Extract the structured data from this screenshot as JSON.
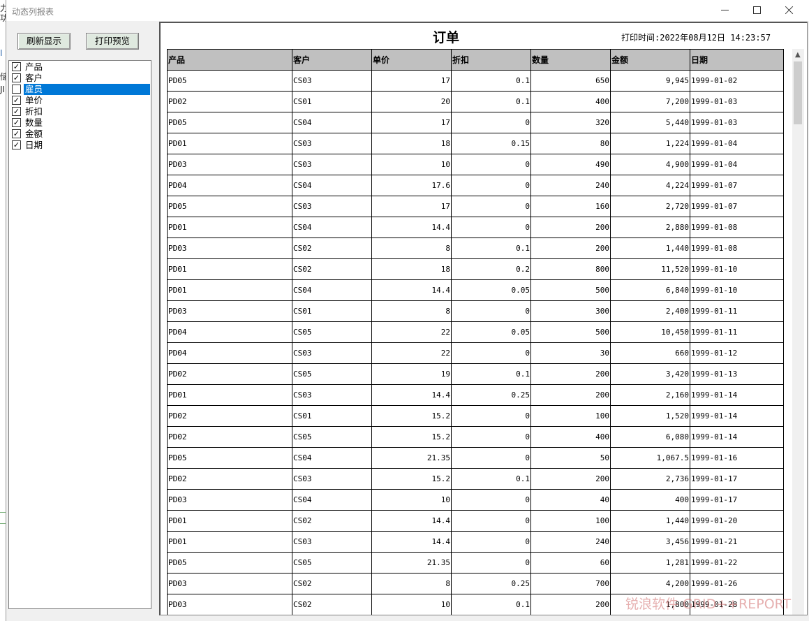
{
  "window": {
    "title": "动态列报表"
  },
  "background_fragments": [
    "力",
    "功",
    "I",
    "储",
    "JI"
  ],
  "toolbar": {
    "refresh_label": "刷新显示",
    "preview_label": "打印预览"
  },
  "columns_panel": {
    "items": [
      {
        "label": "产品",
        "checked": true
      },
      {
        "label": "客户",
        "checked": true
      },
      {
        "label": "雇员",
        "checked": false,
        "selected": true
      },
      {
        "label": "单价",
        "checked": true
      },
      {
        "label": "折扣",
        "checked": true
      },
      {
        "label": "数量",
        "checked": true
      },
      {
        "label": "金额",
        "checked": true
      },
      {
        "label": "日期",
        "checked": true
      }
    ]
  },
  "report": {
    "title": "订单",
    "print_time_label": "打印时间:",
    "print_time": "2022年08月12日 14:23:57",
    "headers": [
      "产品",
      "客户",
      "单价",
      "折扣",
      "数量",
      "金额",
      "日期"
    ],
    "rows": [
      [
        "PD05",
        "CS03",
        "17",
        "0.1",
        "650",
        "9,945",
        "1999-01-02"
      ],
      [
        "PD02",
        "CS01",
        "20",
        "0.1",
        "400",
        "7,200",
        "1999-01-03"
      ],
      [
        "PD05",
        "CS04",
        "17",
        "0",
        "320",
        "5,440",
        "1999-01-03"
      ],
      [
        "PD01",
        "CS03",
        "18",
        "0.15",
        "80",
        "1,224",
        "1999-01-04"
      ],
      [
        "PD03",
        "CS03",
        "10",
        "0",
        "490",
        "4,900",
        "1999-01-04"
      ],
      [
        "PD04",
        "CS04",
        "17.6",
        "0",
        "240",
        "4,224",
        "1999-01-07"
      ],
      [
        "PD05",
        "CS03",
        "17",
        "0",
        "160",
        "2,720",
        "1999-01-07"
      ],
      [
        "PD01",
        "CS04",
        "14.4",
        "0",
        "200",
        "2,880",
        "1999-01-08"
      ],
      [
        "PD03",
        "CS02",
        "8",
        "0.1",
        "200",
        "1,440",
        "1999-01-08"
      ],
      [
        "PD01",
        "CS02",
        "18",
        "0.2",
        "800",
        "11,520",
        "1999-01-10"
      ],
      [
        "PD01",
        "CS04",
        "14.4",
        "0.05",
        "500",
        "6,840",
        "1999-01-10"
      ],
      [
        "PD03",
        "CS01",
        "8",
        "0",
        "300",
        "2,400",
        "1999-01-11"
      ],
      [
        "PD04",
        "CS05",
        "22",
        "0.05",
        "500",
        "10,450",
        "1999-01-11"
      ],
      [
        "PD04",
        "CS03",
        "22",
        "0",
        "30",
        "660",
        "1999-01-12"
      ],
      [
        "PD02",
        "CS05",
        "19",
        "0.1",
        "200",
        "3,420",
        "1999-01-13"
      ],
      [
        "PD01",
        "CS03",
        "14.4",
        "0.25",
        "200",
        "2,160",
        "1999-01-14"
      ],
      [
        "PD02",
        "CS01",
        "15.2",
        "0",
        "100",
        "1,520",
        "1999-01-14"
      ],
      [
        "PD02",
        "CS05",
        "15.2",
        "0",
        "400",
        "6,080",
        "1999-01-14"
      ],
      [
        "PD05",
        "CS04",
        "21.35",
        "0",
        "50",
        "1,067.5",
        "1999-01-16"
      ],
      [
        "PD02",
        "CS03",
        "15.2",
        "0.1",
        "200",
        "2,736",
        "1999-01-17"
      ],
      [
        "PD03",
        "CS04",
        "10",
        "0",
        "40",
        "400",
        "1999-01-17"
      ],
      [
        "PD01",
        "CS02",
        "14.4",
        "0",
        "100",
        "1,440",
        "1999-01-20"
      ],
      [
        "PD01",
        "CS03",
        "14.4",
        "0",
        "240",
        "3,456",
        "1999-01-21"
      ],
      [
        "PD05",
        "CS05",
        "21.35",
        "0",
        "60",
        "1,281",
        "1999-01-22"
      ],
      [
        "PD03",
        "CS02",
        "8",
        "0.25",
        "700",
        "4,200",
        "1999-01-26"
      ],
      [
        "PD03",
        "CS02",
        "10",
        "0.1",
        "200",
        "1,800",
        "1999-01-28"
      ]
    ]
  },
  "watermark": "锐浪软件 GRID++REPORT",
  "colors": {
    "selection": "#0078d7",
    "header_bg": "#c0c0c0",
    "button_bg": "#dfe9df"
  }
}
